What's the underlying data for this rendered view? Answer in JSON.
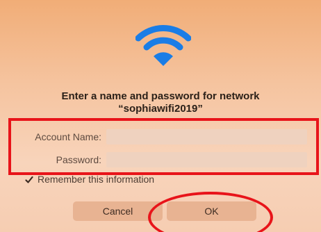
{
  "dialog": {
    "title_line1": "Enter a name and password for network",
    "title_line2": "“sophiawifi2019”",
    "icon": "wifi-icon",
    "accent_color": "#1a7de6"
  },
  "form": {
    "account_label": "Account Name:",
    "account_value": "",
    "password_label": "Password:",
    "password_value": ""
  },
  "remember": {
    "label": "Remember this information",
    "checked": true
  },
  "buttons": {
    "cancel": "Cancel",
    "ok": "OK"
  },
  "annotations": {
    "highlight_color": "#e8141a"
  }
}
